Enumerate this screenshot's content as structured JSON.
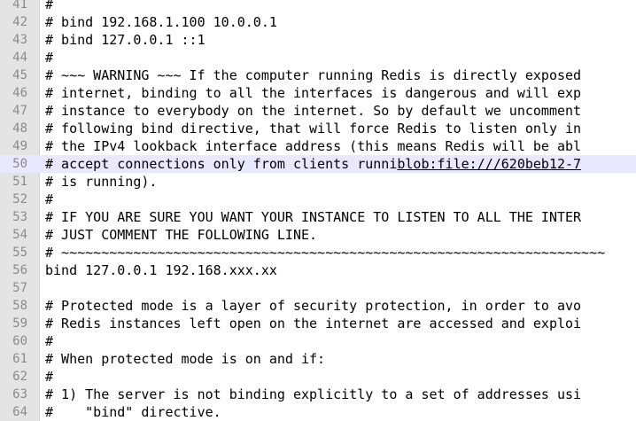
{
  "editor": {
    "lines": [
      {
        "num": "41",
        "text": "#"
      },
      {
        "num": "42",
        "text": "# bind 192.168.1.100 10.0.0.1"
      },
      {
        "num": "43",
        "text": "# bind 127.0.0.1 ::1"
      },
      {
        "num": "44",
        "text": "#"
      },
      {
        "num": "45",
        "text": "# ~~~ WARNING ~~~ If the computer running Redis is directly exposed"
      },
      {
        "num": "46",
        "text": "# internet, binding to all the interfaces is dangerous and will exp"
      },
      {
        "num": "47",
        "text": "# instance to everybody on the internet. So by default we uncomment"
      },
      {
        "num": "48",
        "text": "# following bind directive, that will force Redis to listen only in"
      },
      {
        "num": "49",
        "text": "# the IPv4 lookback interface address (this means Redis will be abl"
      },
      {
        "num": "50",
        "text": "# accept connections only from clients runni",
        "link": "blob:file:///620beb12-7"
      },
      {
        "num": "51",
        "text": "# is running)."
      },
      {
        "num": "52",
        "text": "#"
      },
      {
        "num": "53",
        "text": "# IF YOU ARE SURE YOU WANT YOUR INSTANCE TO LISTEN TO ALL THE INTER"
      },
      {
        "num": "54",
        "text": "# JUST COMMENT THE FOLLOWING LINE."
      },
      {
        "num": "55",
        "text": "# ~~~~~~~~~~~~~~~~~~~~~~~~~~~~~~~~~~~~~~~~~~~~~~~~~~~~~~~~~~~~~~~~~~~~"
      },
      {
        "num": "56",
        "text": "bind 127.0.0.1 192.168.xxx.xx"
      },
      {
        "num": "57",
        "text": ""
      },
      {
        "num": "58",
        "text": "# Protected mode is a layer of security protection, in order to avo"
      },
      {
        "num": "59",
        "text": "# Redis instances left open on the internet are accessed and exploi"
      },
      {
        "num": "60",
        "text": "#"
      },
      {
        "num": "61",
        "text": "# When protected mode is on and if:"
      },
      {
        "num": "62",
        "text": "#"
      },
      {
        "num": "63",
        "text": "# 1) The server is not binding explicitly to a set of addresses usi"
      },
      {
        "num": "64",
        "text": "#    \"bind\" directive."
      }
    ]
  }
}
